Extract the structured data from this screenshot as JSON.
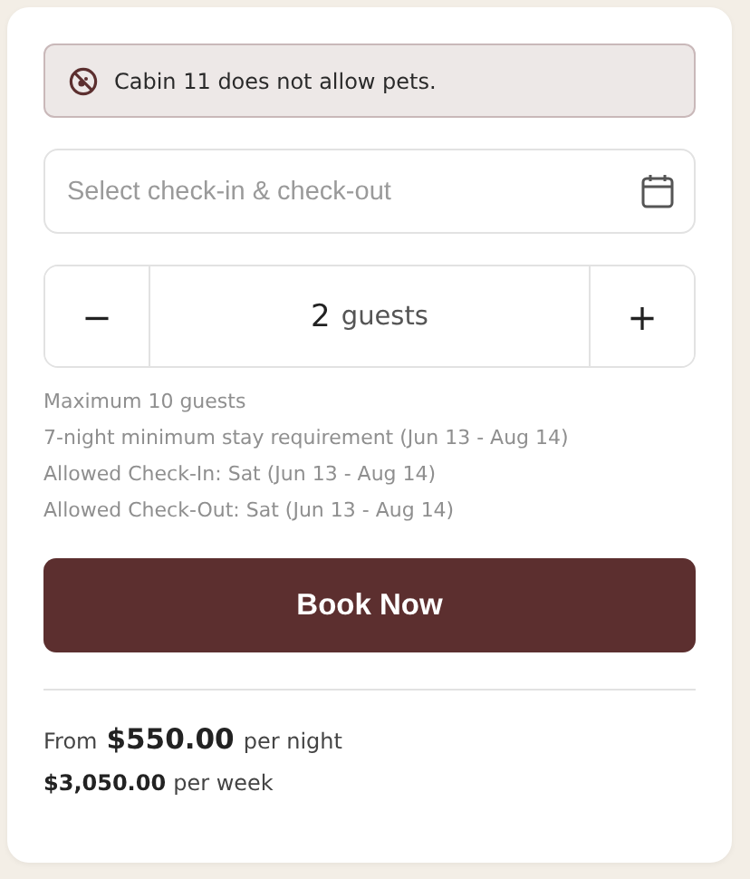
{
  "notice": {
    "text": "Cabin 11 does not allow pets."
  },
  "date_field": {
    "placeholder": "Select check-in & check-out"
  },
  "guests": {
    "decrement": "−",
    "count": "2",
    "unit": "guests",
    "increment": "+"
  },
  "notes": [
    "Maximum 10 guests",
    "7-night minimum stay requirement (Jun 13 - Aug 14)",
    "Allowed Check-In: Sat (Jun 13 - Aug 14)",
    "Allowed Check-Out: Sat (Jun 13 - Aug 14)"
  ],
  "book_button": "Book Now",
  "nightly": {
    "prefix": "From",
    "amount": "$550.00",
    "suffix": "per night"
  },
  "weekly": {
    "amount": "$3,050.00",
    "suffix": "per week"
  }
}
